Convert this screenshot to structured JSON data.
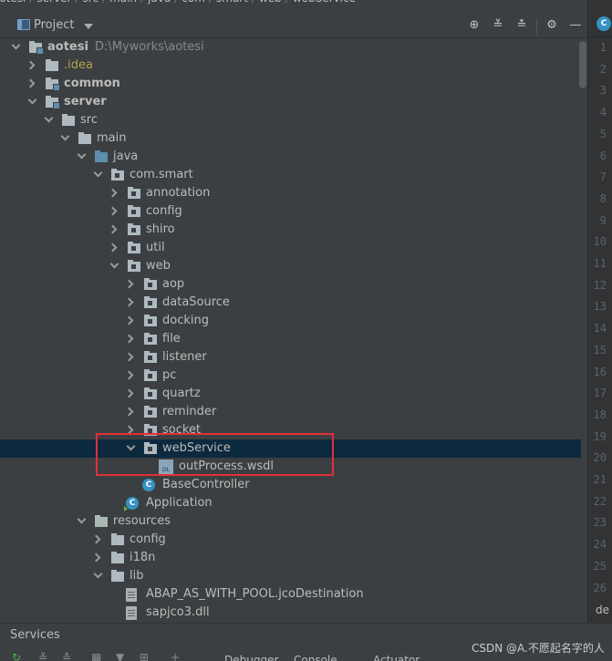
{
  "breadcrumb": [
    "aotesi",
    "server",
    "src",
    "main",
    "java",
    "com",
    "smart",
    "web",
    "webService"
  ],
  "panel": {
    "title": "Project"
  },
  "tree": {
    "rows": [
      {
        "label": "aotesi",
        "path": "D:\\Myworks\\aotesi",
        "bold": true,
        "expanded": true,
        "icon": "module-folder-icon",
        "depth": 0
      },
      {
        "label": ".idea",
        "expanded": false,
        "icon": "folder-icon",
        "depth": 1,
        "style": "idea"
      },
      {
        "label": "common",
        "bold": true,
        "expanded": false,
        "icon": "module-folder-icon",
        "depth": 1
      },
      {
        "label": "server",
        "bold": true,
        "expanded": true,
        "icon": "module-folder-icon",
        "depth": 1
      },
      {
        "label": "src",
        "expanded": true,
        "icon": "folder-icon",
        "depth": 2
      },
      {
        "label": "main",
        "expanded": true,
        "icon": "folder-icon",
        "depth": 3
      },
      {
        "label": "java",
        "expanded": true,
        "icon": "source-folder-icon",
        "depth": 4
      },
      {
        "label": "com.smart",
        "expanded": true,
        "icon": "package-icon",
        "depth": 5
      },
      {
        "label": "annotation",
        "expanded": false,
        "icon": "package-icon",
        "depth": 6
      },
      {
        "label": "config",
        "expanded": false,
        "icon": "package-icon",
        "depth": 6
      },
      {
        "label": "shiro",
        "expanded": false,
        "icon": "package-icon",
        "depth": 6
      },
      {
        "label": "util",
        "expanded": false,
        "icon": "package-icon",
        "depth": 6
      },
      {
        "label": "web",
        "expanded": true,
        "icon": "package-icon",
        "depth": 6
      },
      {
        "label": "aop",
        "expanded": false,
        "icon": "package-icon",
        "depth": 7
      },
      {
        "label": "dataSource",
        "expanded": false,
        "icon": "package-icon",
        "depth": 7
      },
      {
        "label": "docking",
        "expanded": false,
        "icon": "package-icon",
        "depth": 7
      },
      {
        "label": "file",
        "expanded": false,
        "icon": "package-icon",
        "depth": 7
      },
      {
        "label": "listener",
        "expanded": false,
        "icon": "package-icon",
        "depth": 7
      },
      {
        "label": "pc",
        "expanded": false,
        "icon": "package-icon",
        "depth": 7
      },
      {
        "label": "quartz",
        "expanded": false,
        "icon": "package-icon",
        "depth": 7
      },
      {
        "label": "reminder",
        "expanded": false,
        "icon": "package-icon",
        "depth": 7
      },
      {
        "label": "socket",
        "expanded": false,
        "icon": "package-icon",
        "depth": 7
      },
      {
        "label": "webService",
        "expanded": true,
        "icon": "package-icon",
        "depth": 7,
        "selected": true
      },
      {
        "label": "outProcess.wsdl",
        "icon": "wsdl-file-icon",
        "depth": 8,
        "leaf": true
      },
      {
        "label": "BaseController",
        "icon": "class-icon",
        "depth": 7,
        "leaf": true
      },
      {
        "label": "Application",
        "icon": "application-class-icon",
        "depth": 6,
        "leaf": true
      },
      {
        "label": "resources",
        "expanded": true,
        "icon": "resources-folder-icon",
        "depth": 4
      },
      {
        "label": "config",
        "expanded": false,
        "icon": "folder-icon",
        "depth": 5
      },
      {
        "label": "i18n",
        "expanded": false,
        "icon": "folder-icon",
        "depth": 5
      },
      {
        "label": "lib",
        "expanded": true,
        "icon": "folder-icon",
        "depth": 5
      },
      {
        "label": "ABAP_AS_WITH_POOL.jcoDestination",
        "icon": "text-file-icon",
        "depth": 6,
        "leaf": true
      },
      {
        "label": "sapjco3.dll",
        "icon": "text-file-icon",
        "depth": 6,
        "leaf": true
      }
    ]
  },
  "gutter": {
    "lines": [
      "1",
      "2",
      "3",
      "4",
      "5",
      "6",
      "7",
      "8",
      "9",
      "10",
      "11",
      "12",
      "13",
      "14",
      "15",
      "16",
      "17",
      "18",
      "19",
      "20",
      "21",
      "22",
      "23",
      "24",
      "25",
      "26"
    ],
    "side_tab": "de"
  },
  "bottom": {
    "title": "Services",
    "tabs": [
      "Debugger",
      "Console",
      "Actuator"
    ],
    "watermark": "CSDN @A.不愿起名字的人"
  },
  "colors": {
    "highlight_box": "#e0303a",
    "selection": "#0d293e",
    "idea_folder_text": "#b0a24d"
  }
}
